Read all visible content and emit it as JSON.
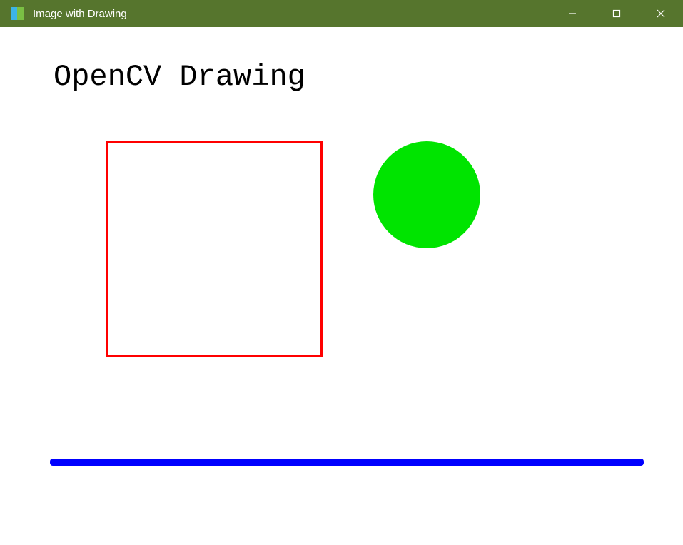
{
  "window": {
    "title": "Image with Drawing"
  },
  "canvas": {
    "heading": "OpenCV Drawing",
    "shapes": {
      "rectangle": {
        "stroke": "#ff0000",
        "fill": "none"
      },
      "circle": {
        "fill": "#00e400"
      },
      "line": {
        "stroke": "#0000ff"
      }
    }
  }
}
